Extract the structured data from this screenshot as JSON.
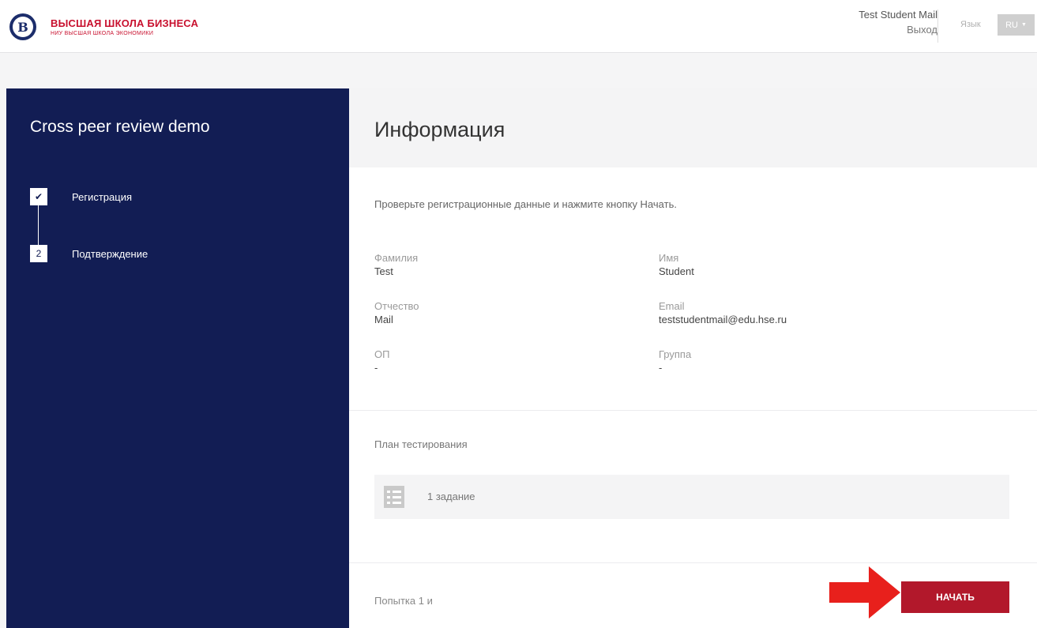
{
  "header": {
    "logo": {
      "title": "ВЫСШАЯ ШКОЛА БИЗНЕСА",
      "subtitle": "НИУ ВЫСШАЯ ШКОЛА ЭКОНОМИКИ",
      "icon": "hse-logo-icon"
    },
    "user_name": "Test Student Mail",
    "logout_label": "Выход",
    "language_label": "Язык",
    "language_value": "RU"
  },
  "sidebar": {
    "course_title": "Cross peer review demo",
    "steps": [
      {
        "marker": "✔",
        "label": "Регистрация",
        "status": "done"
      },
      {
        "marker": "2",
        "label": "Подтверждение",
        "status": "current"
      }
    ]
  },
  "main": {
    "title": "Информация",
    "instructions": "Проверьте регистрационные данные и нажмите кнопку Начать.",
    "fields": {
      "surname": {
        "label": "Фамилия",
        "value": "Test"
      },
      "name": {
        "label": "Имя",
        "value": "Student"
      },
      "patronymic": {
        "label": "Отчество",
        "value": "Mail"
      },
      "email": {
        "label": "Email",
        "value": "teststudentmail@edu.hse.ru"
      },
      "program": {
        "label": "ОП",
        "value": "-"
      },
      "group": {
        "label": "Группа",
        "value": "-"
      }
    },
    "plan": {
      "title": "План тестирования",
      "item": "1 задание",
      "icon": "list-icon"
    },
    "attempt": "Попытка 1 и",
    "start_label": "НАЧАТЬ"
  },
  "colors": {
    "sidebar_bg": "#121d54",
    "brand_red": "#c8102e",
    "button_bg": "#b2182b",
    "arrow": "#e8201c"
  }
}
